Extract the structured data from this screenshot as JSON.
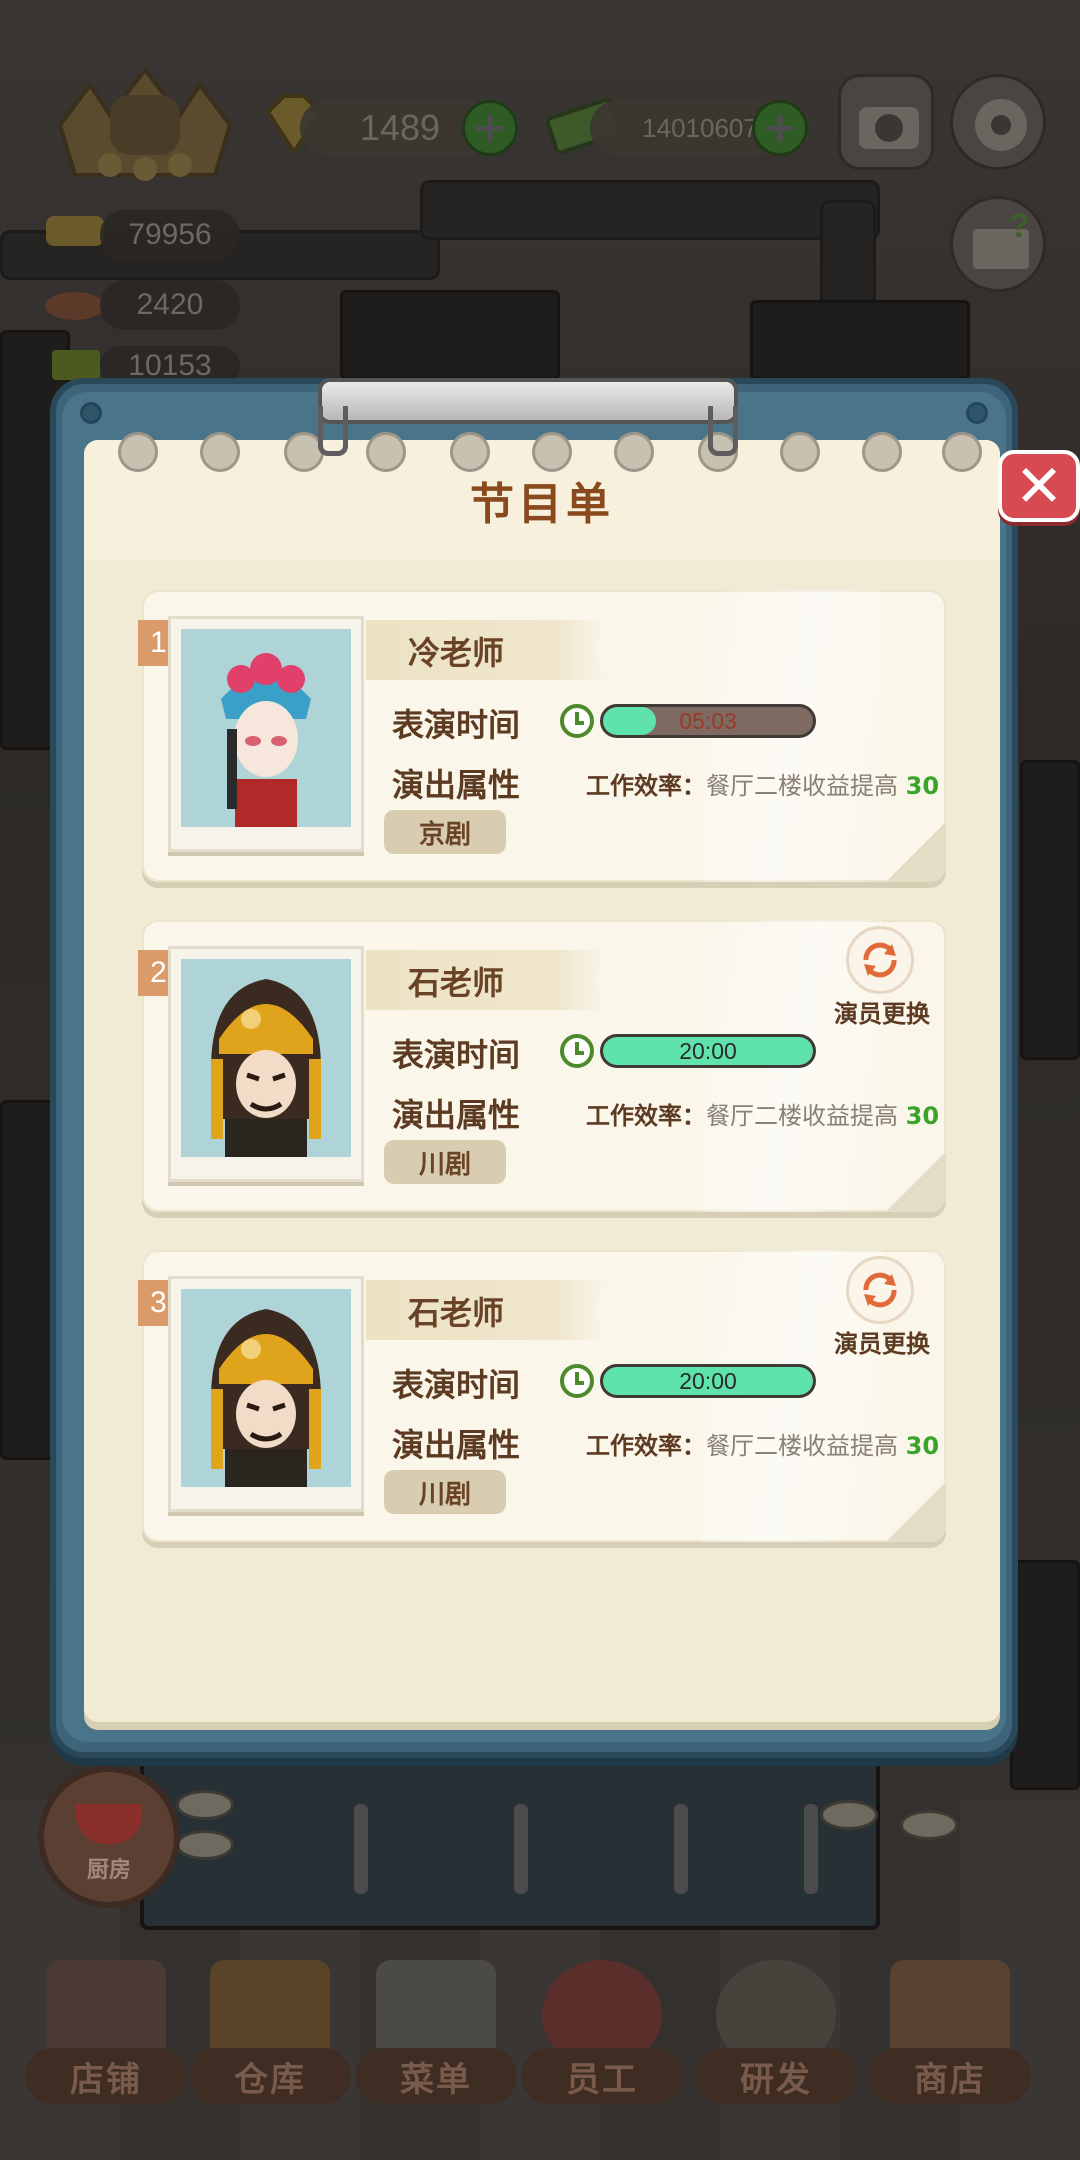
{
  "hud": {
    "gems": "1489",
    "cash": "14010607",
    "stat_1": "79956",
    "stat_2": "2420",
    "stat_3": "10153",
    "plus_symbol": "+"
  },
  "modal": {
    "title": "节目单",
    "close_symbol": "✕"
  },
  "performers": [
    {
      "index": "1",
      "name": "冷老师",
      "time_label": "表演时间",
      "time": "05:03",
      "time_progress": 0.25,
      "attr_label": "演出属性",
      "effect_label": "工作效率：",
      "effect_desc": "餐厅二楼收益提高",
      "effect_value": "30",
      "genre": "京剧",
      "swap_label": ""
    },
    {
      "index": "2",
      "name": "石老师",
      "time_label": "表演时间",
      "time": "20:00",
      "time_progress": 1.0,
      "attr_label": "演出属性",
      "effect_label": "工作效率：",
      "effect_desc": "餐厅二楼收益提高",
      "effect_value": "30",
      "genre": "川剧",
      "swap_label": "演员更换"
    },
    {
      "index": "3",
      "name": "石老师",
      "time_label": "表演时间",
      "time": "20:00",
      "time_progress": 1.0,
      "attr_label": "演出属性",
      "effect_label": "工作效率：",
      "effect_desc": "餐厅二楼收益提高",
      "effect_value": "30",
      "genre": "川剧",
      "swap_label": "演员更换"
    }
  ],
  "kitchen": {
    "label": "厨房"
  },
  "nav": [
    {
      "label": "店铺",
      "icon": "shop-building-icon"
    },
    {
      "label": "仓库",
      "icon": "warehouse-boxes-icon"
    },
    {
      "label": "菜单",
      "icon": "menu-clipboard-icon"
    },
    {
      "label": "员工",
      "icon": "staff-chef-icon"
    },
    {
      "label": "研发",
      "icon": "research-wok-icon"
    },
    {
      "label": "商店",
      "icon": "store-icon"
    }
  ],
  "colors": {
    "accent_green": "#5ee3ad",
    "title_brown": "#8a4a1e",
    "close_red": "#d84a51",
    "board_blue": "#3d6478",
    "efficiency_green": "#3aa32a"
  }
}
